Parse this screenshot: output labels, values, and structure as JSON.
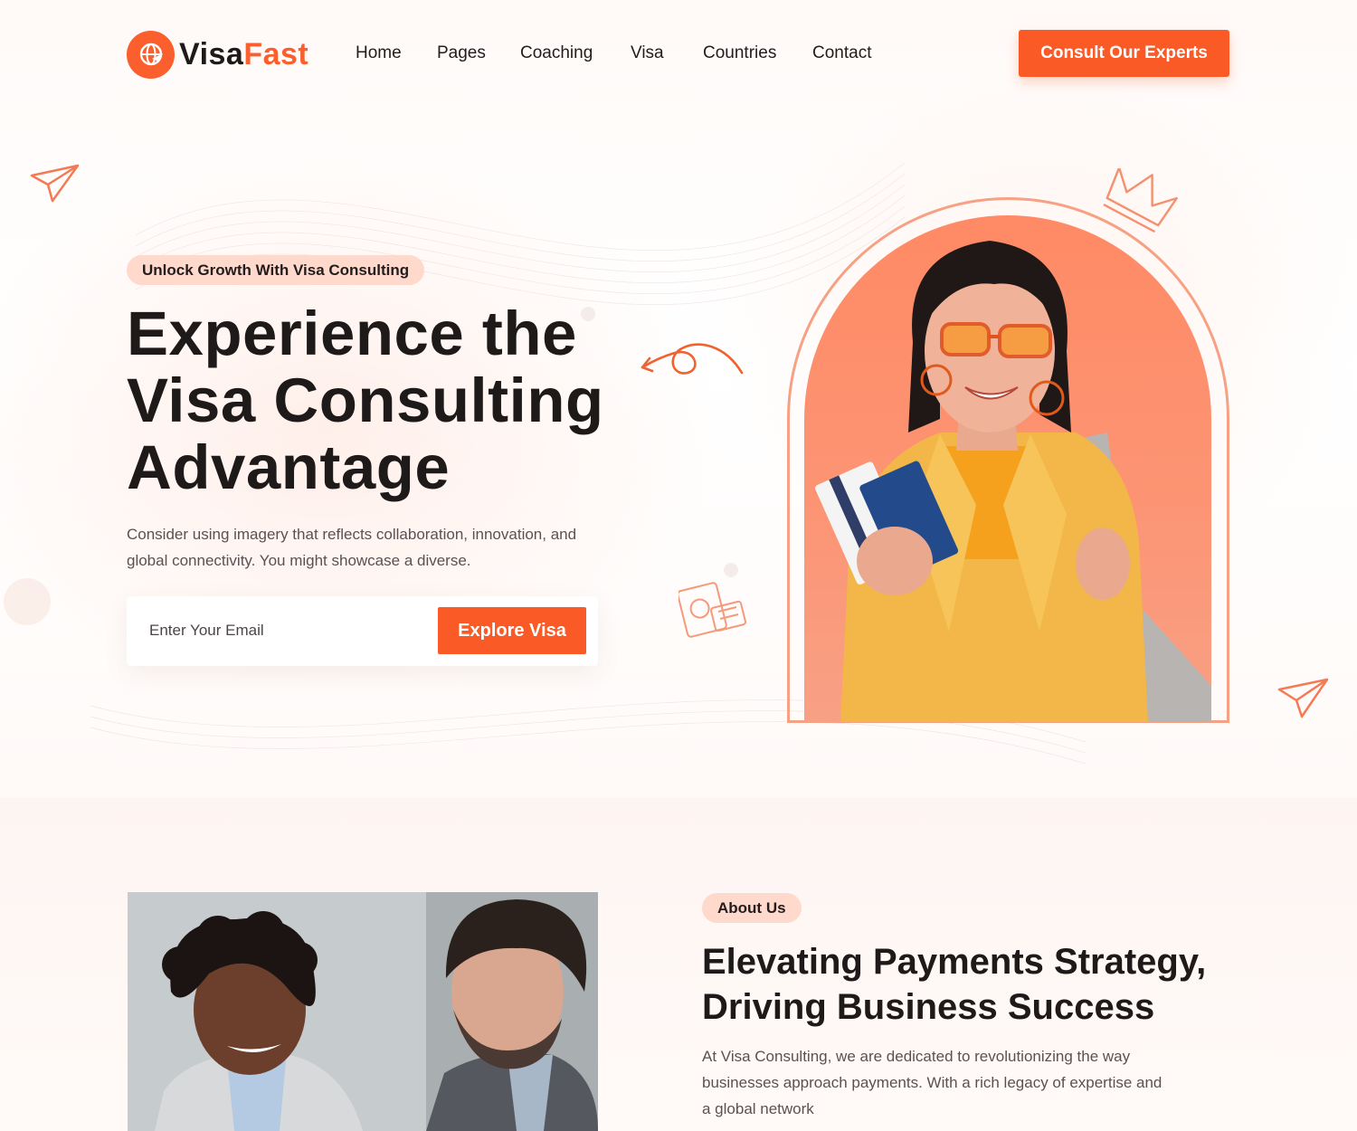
{
  "brand": {
    "name_part1": "Visa",
    "name_part2": "Fast",
    "accent_color": "#fa5a26",
    "logo_icon": "globe-plane-icon"
  },
  "nav": {
    "items": [
      {
        "label": "Home"
      },
      {
        "label": "Pages"
      },
      {
        "label": "Coaching"
      },
      {
        "label": "Visa"
      },
      {
        "label": "Countries"
      },
      {
        "label": "Contact"
      }
    ],
    "cta_label": "Consult Our Experts"
  },
  "hero": {
    "badge": "Unlock Growth With Visa Consulting",
    "title_line1": "Experience the",
    "title_line2": "Visa Consulting",
    "title_line3": "Advantage",
    "description": "Consider using imagery that reflects collaboration, innovation, and global connectivity. You might showcase a diverse.",
    "email_placeholder": "Enter Your Email",
    "button_label": "Explore Visa"
  },
  "about": {
    "badge": "About Us",
    "title_line1": "Elevating Payments Strategy,",
    "title_line2": "Driving Business Success",
    "description": "At Visa Consulting, we are dedicated to revolutionizing the way businesses approach payments. With a rich legacy of expertise and a global network"
  }
}
